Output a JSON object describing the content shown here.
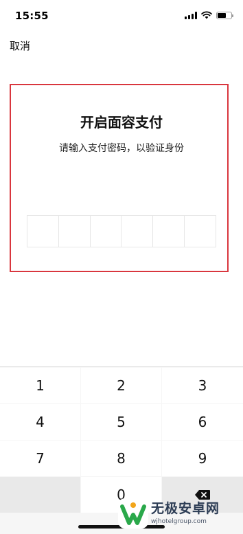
{
  "status_bar": {
    "time": "15:55",
    "icons": [
      "signal-icon",
      "wifi-icon",
      "battery-icon"
    ]
  },
  "nav": {
    "cancel_label": "取消"
  },
  "dialog": {
    "title": "开启面容支付",
    "subtitle": "请输入支付密码，以验证身份",
    "pin_length": 6,
    "highlight_color": "#d9363e"
  },
  "keypad": {
    "keys": [
      "1",
      "2",
      "3",
      "4",
      "5",
      "6",
      "7",
      "8",
      "9",
      "",
      "0",
      "backspace-icon"
    ]
  },
  "watermark": {
    "name": "无极安卓网",
    "url": "wjhotelgroup.com"
  }
}
